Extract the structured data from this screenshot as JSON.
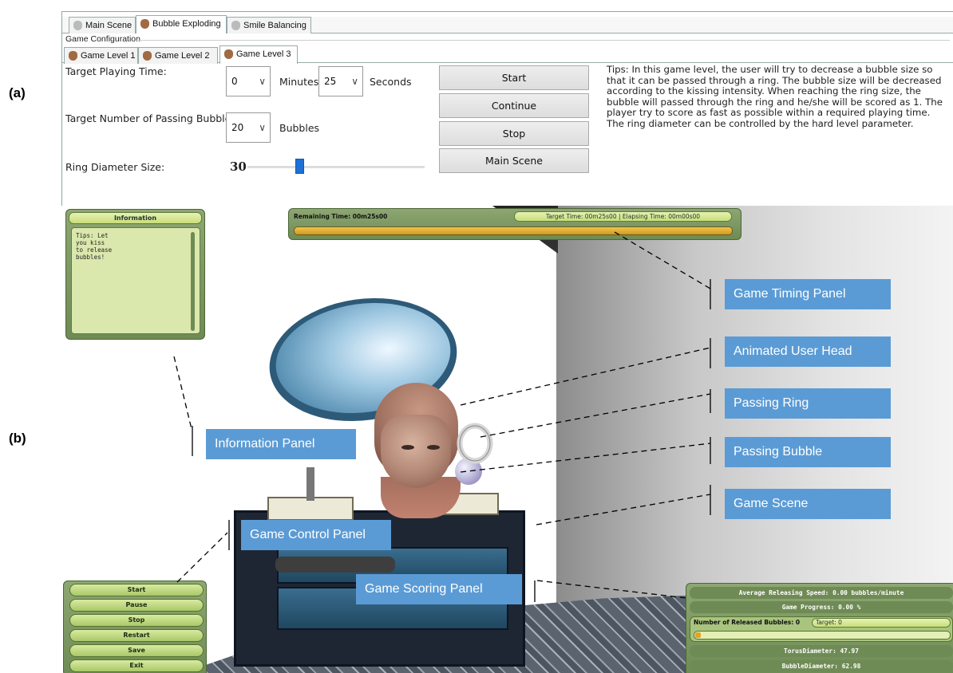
{
  "figure_labels": {
    "a": "(a)",
    "b": "(b)"
  },
  "top_tabs": [
    {
      "label": "Main Scene",
      "icon": "scene-icon"
    },
    {
      "label": "Bubble Exploding",
      "icon": "bubble-head-icon",
      "active": true
    },
    {
      "label": "Smile Balancing",
      "icon": "smile-icon"
    }
  ],
  "group_title": "Game Configuration",
  "level_tabs": [
    {
      "label": "Game Level 1"
    },
    {
      "label": "Game Level 2"
    },
    {
      "label": "Game Level 3",
      "active": true
    }
  ],
  "config": {
    "target_time_label": "Target Playing Time:",
    "minutes_value": "0",
    "minutes_unit": "Minutes",
    "seconds_value": "25",
    "seconds_unit": "Seconds",
    "target_bubbles_label": "Target Number of Passing Bubbles:",
    "bubbles_value": "20",
    "bubbles_unit": "Bubbles",
    "ring_label": "Ring Diameter Size:",
    "ring_value": "30"
  },
  "buttons": {
    "start": "Start",
    "continue": "Continue",
    "stop": "Stop",
    "main_scene": "Main Scene"
  },
  "tips": "Tips: In this game level, the user will try to decrease a bubble size so that it can be passed through a ring. The bubble size will be decreased according to the kissing intensity. When reaching the ring size, the bubble will passed through the ring and he/she will be scored as 1. The player try to score as fast as possible within a required playing time. The ring diameter can be controlled by the hard level parameter.",
  "info_panel": {
    "title": "Information",
    "text": "Tips: Let you kiss to release bubbles!"
  },
  "timing_panel": {
    "remaining": "Remaining Time: 00m25s00",
    "target_elapsing": "Target Time: 00m25s00 | Elapsing Time: 00m00s00"
  },
  "control_panel": [
    "Start",
    "Pause",
    "Stop",
    "Restart",
    "Save",
    "Exit"
  ],
  "scoring_panel": {
    "speed": "Average Releasing Speed: 0.00 bubbles/minute",
    "progress": "Game Progress: 0.00 %",
    "released": "Number of Released Bubbles: 0",
    "target": "Target: 0",
    "torus": "TorusDiameter: 47.97",
    "bubble": "BubbleDiameter: 62.98"
  },
  "callouts": {
    "timing": "Game Timing Panel",
    "head": "Animated User Head",
    "ring": "Passing Ring",
    "bubble": "Passing Bubble",
    "scene": "Game Scene",
    "info": "Information Panel",
    "control": "Game Control Panel",
    "scoring": "Game Scoring Panel"
  },
  "colors": {
    "callout": "#5b9bd5",
    "panel_green": "#7d9863",
    "slider": "#1e70d6"
  }
}
